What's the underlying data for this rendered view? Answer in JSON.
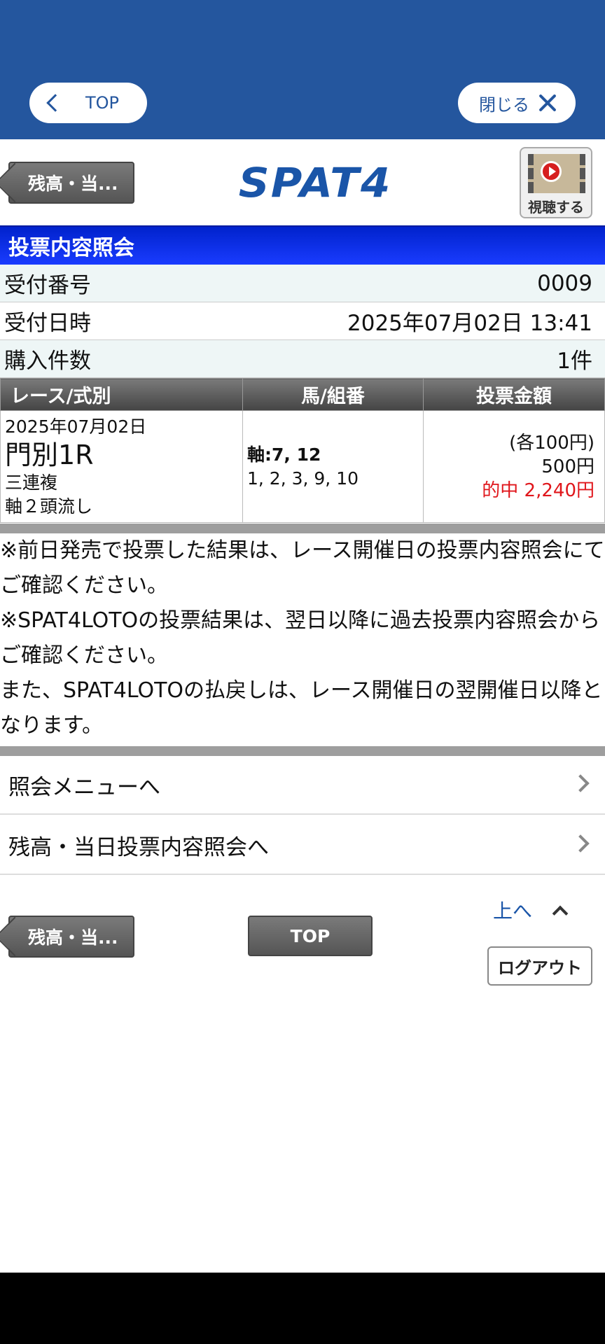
{
  "topbar": {
    "top_label": "TOP",
    "close_label": "閉じる"
  },
  "header": {
    "back_label": "残高・当...",
    "logo": "SPAT4",
    "watch_label": "視聴する"
  },
  "section_title": "投票内容照会",
  "info": [
    {
      "label": "受付番号",
      "value": "0009"
    },
    {
      "label": "受付日時",
      "value": "2025年07月02日 13:41"
    },
    {
      "label": "購入件数",
      "value": "1件"
    }
  ],
  "table": {
    "headers": [
      "レース/式別",
      "馬/組番",
      "投票金額"
    ],
    "row": {
      "date": "2025年07月02日",
      "race": "門別1R",
      "bet_type": "三連複",
      "method": "軸２頭流し",
      "axis": "軸:7, 12",
      "partners": "1, 2, 3, 9, 10",
      "unit": "(各100円)",
      "total": "500円",
      "payout": "的中  2,240円"
    }
  },
  "notes": [
    "※前日発売で投票した結果は、レース開催日の投票内容照会にてご確認ください。",
    "※SPAT4LOTOの投票結果は、翌日以降に過去投票内容照会からご確認ください。",
    "また、SPAT4LOTOの払戻しは、レース開催日の翌開催日以降となります。"
  ],
  "menu": [
    "照会メニューへ",
    "残高・当日投票内容照会へ"
  ],
  "footer": {
    "back_label": "残高・当...",
    "top_label": "TOP",
    "up_label": "上へ",
    "logout_label": "ログアウト"
  },
  "colors": {
    "brand_blue": "#24569e",
    "section_blue": "#0022cc",
    "hit_red": "#e0161b"
  }
}
